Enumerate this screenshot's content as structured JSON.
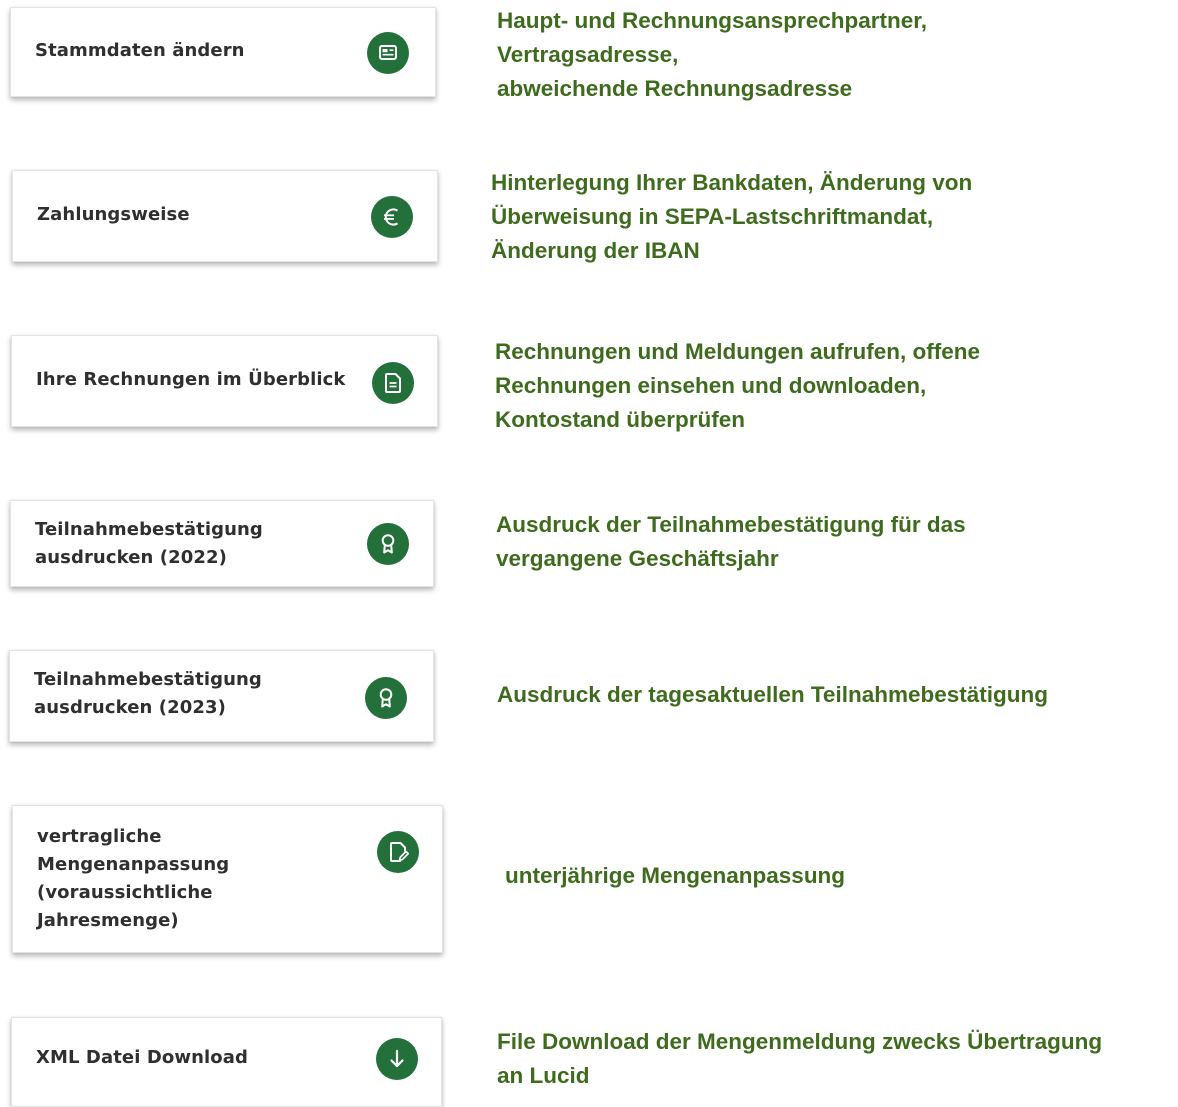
{
  "colors": {
    "icon_background": "#24703a",
    "description_text": "#3f6b1e",
    "card_text": "#2f2f2f"
  },
  "items": [
    {
      "card_label": "Stammdaten ändern",
      "icon": "id-card-icon",
      "description": "Haupt- und Rechnungsansprechpartner,\nVertragsadresse,\nabweichende Rechnungsadresse"
    },
    {
      "card_label": "Zahlungsweise",
      "icon": "euro-icon",
      "description": "Hinterlegung Ihrer Bankdaten, Änderung von\nÜberweisung in SEPA-Lastschriftmandat,\nÄnderung der IBAN"
    },
    {
      "card_label": "Ihre Rechnungen im Überblick",
      "icon": "document-icon",
      "description": "Rechnungen und Meldungen aufrufen, offene\nRechnungen einsehen und downloaden,\nKontostand überprüfen"
    },
    {
      "card_label": "Teilnahmebestätigung\nausdrucken (2022)",
      "icon": "award-icon",
      "description": "Ausdruck der Teilnahmebestätigung für das\nvergangene Geschäftsjahr"
    },
    {
      "card_label": "Teilnahmebestätigung\nausdrucken (2023)",
      "icon": "award-icon",
      "description": "Ausdruck der tagesaktuellen Teilnahmebestätigung"
    },
    {
      "card_label": "vertragliche\nMengenanpassung\n(voraussichtliche\nJahresmenge)",
      "icon": "edit-document-icon",
      "description": "unterjährige Mengenanpassung"
    },
    {
      "card_label": "XML Datei Download",
      "icon": "download-arrow-icon",
      "description": "File Download der Mengenmeldung zwecks Übertragung\nan Lucid"
    }
  ]
}
